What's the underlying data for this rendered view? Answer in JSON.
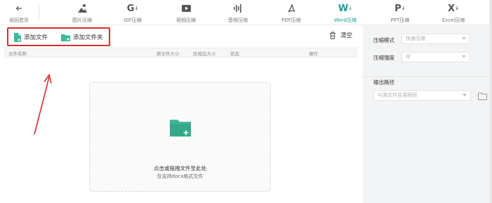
{
  "toolbar": {
    "back_label": "返回首页",
    "items": [
      {
        "label": "图片压缩",
        "icon": "image-compress-icon"
      },
      {
        "label": "GIF压缩",
        "icon": "gif-compress-icon"
      },
      {
        "label": "视频压缩",
        "icon": "video-compress-icon"
      },
      {
        "label": "音频压缩",
        "icon": "audio-compress-icon"
      },
      {
        "label": "PDF压缩",
        "icon": "pdf-compress-icon"
      },
      {
        "label": "Word压缩",
        "icon": "word-compress-icon",
        "active": true
      },
      {
        "label": "PPT压缩",
        "icon": "ppt-compress-icon"
      },
      {
        "label": "Excel压缩",
        "icon": "excel-compress-icon"
      }
    ],
    "active_color": "#1aa090"
  },
  "actions": {
    "add_file": "添加文件",
    "add_folder": "添加文件夹",
    "clear": "清空",
    "highlight_color": "#d92c2c"
  },
  "table": {
    "columns": [
      "文件名称",
      "原文件大小",
      "压缩后大小",
      "状态",
      "操作"
    ]
  },
  "dropzone": {
    "title": "点击或拖拽文件至此处",
    "hint": "仅支持docx格式文件"
  },
  "settings": {
    "mode_label": "压缩模式",
    "mode_value": "快速压缩",
    "strength_label": "压缩强度",
    "strength_value": "中",
    "output_label": "输出路径",
    "output_value": "与源文件目录相同"
  },
  "colors": {
    "accent": "#1aa090",
    "icon_green": "#3cb89a"
  }
}
